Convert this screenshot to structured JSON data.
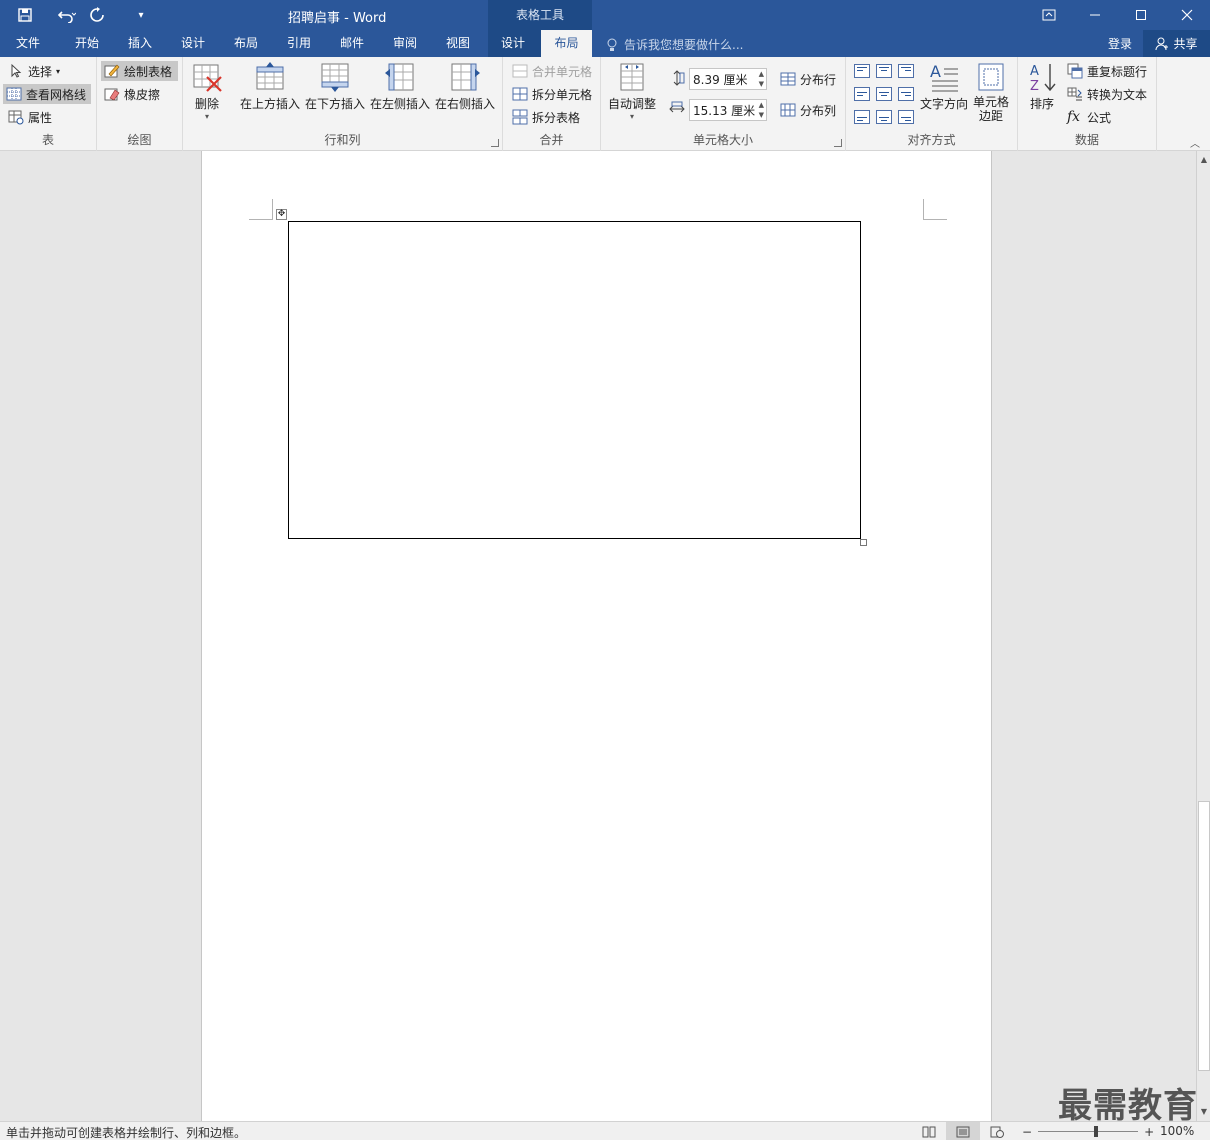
{
  "window": {
    "title": "招聘启事 - Word",
    "context_tab_group": "表格工具",
    "quick_access": {
      "save": "save-icon",
      "undo": "undo-icon",
      "redo": "redo-icon",
      "customize": "customize-qat-icon"
    }
  },
  "tabs": [
    {
      "label": "文件"
    },
    {
      "label": "开始"
    },
    {
      "label": "插入"
    },
    {
      "label": "设计"
    },
    {
      "label": "布局"
    },
    {
      "label": "引用"
    },
    {
      "label": "邮件"
    },
    {
      "label": "审阅"
    },
    {
      "label": "视图"
    },
    {
      "label": "设计"
    },
    {
      "label": "布局",
      "active": true
    }
  ],
  "tell_me": "告诉我您想要做什么...",
  "account": {
    "login": "登录",
    "share": "共享"
  },
  "ribbon": {
    "table": {
      "label": "表",
      "select": "选择",
      "view_gridlines": "查看网格线",
      "properties": "属性"
    },
    "draw": {
      "label": "绘图",
      "draw_table": "绘制表格",
      "eraser": "橡皮擦"
    },
    "rows_cols": {
      "label": "行和列",
      "delete": "删除",
      "insert_above": "在上方插入",
      "insert_below": "在下方插入",
      "insert_left": "在左侧插入",
      "insert_right": "在右侧插入"
    },
    "merge": {
      "label": "合并",
      "merge_cells": "合并单元格",
      "split_cells": "拆分单元格",
      "split_table": "拆分表格"
    },
    "cell_size": {
      "label": "单元格大小",
      "autofit": "自动调整",
      "height": "8.39 厘米",
      "width": "15.13 厘米",
      "distribute_rows": "分布行",
      "distribute_cols": "分布列"
    },
    "alignment": {
      "label": "对齐方式",
      "text_direction": "文字方向",
      "cell_margins_1": "单元格",
      "cell_margins_2": "边距"
    },
    "data": {
      "label": "数据",
      "sort": "排序",
      "repeat_header": "重复标题行",
      "convert_to_text": "转换为文本",
      "formula": "公式"
    }
  },
  "status": {
    "message": "单击并拖动可创建表格并绘制行、列和边框。",
    "zoom": "100%"
  },
  "watermark": "最需教育",
  "colors": {
    "brand": "#2b579a",
    "context": "#1e4a86"
  }
}
